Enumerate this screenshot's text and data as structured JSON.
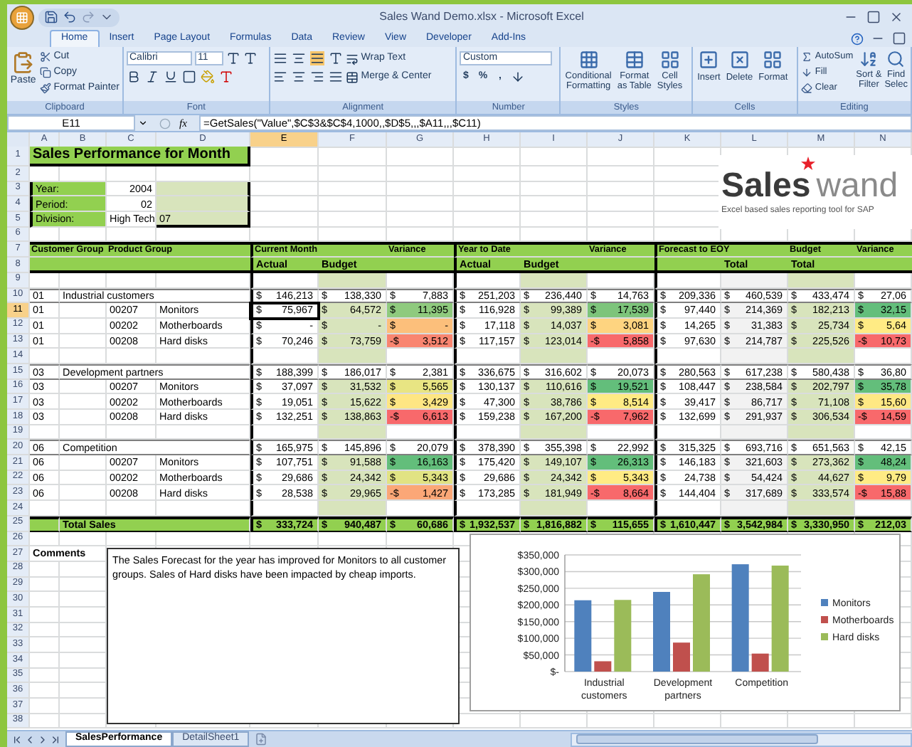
{
  "window": {
    "title": "Sales Wand Demo.xlsx - Microsoft Excel"
  },
  "ribbon": {
    "tabs": [
      {
        "label": "Home",
        "selected": true
      },
      {
        "label": "Insert",
        "selected": false
      },
      {
        "label": "Page Layout",
        "selected": false
      },
      {
        "label": "Formulas",
        "selected": false
      },
      {
        "label": "Data",
        "selected": false
      },
      {
        "label": "Review",
        "selected": false
      },
      {
        "label": "View",
        "selected": false
      },
      {
        "label": "Developer",
        "selected": false
      },
      {
        "label": "Add-Ins",
        "selected": false
      }
    ],
    "clipboard": {
      "label": "Clipboard",
      "paste": "Paste",
      "items": [
        "Cut",
        "Copy",
        "Format Painter"
      ]
    },
    "font": {
      "label": "Font",
      "family": "Calibri",
      "size": "11"
    },
    "alignment": {
      "label": "Alignment",
      "wrap": "Wrap Text",
      "merge": "Merge & Center"
    },
    "number": {
      "label": "Number",
      "format": "Custom",
      "symbols": [
        "$",
        "%",
        ","
      ]
    },
    "styles": {
      "label": "Styles",
      "buttons": [
        [
          "Conditional",
          "Formatting"
        ],
        [
          "Format",
          "as Table"
        ],
        [
          "Cell",
          "Styles"
        ]
      ]
    },
    "cells": {
      "label": "Cells",
      "buttons": [
        "Insert",
        "Delete",
        "Format"
      ]
    },
    "editing": {
      "label": "Editing",
      "items": [
        "AutoSum",
        "Fill",
        "Clear"
      ],
      "buttons": [
        [
          "Sort &",
          "Filter"
        ],
        [
          "Find",
          "Selec"
        ]
      ]
    }
  },
  "formula_bar": {
    "name_box": "E11",
    "function_label": "fx",
    "formula": "=GetSales(\"Value\",$C$3&$C$4,1000,,$D$5,,,$A11,,,$C11)"
  },
  "sheet": {
    "columns": [
      {
        "label": "A",
        "selected": false
      },
      {
        "label": "B",
        "selected": false
      },
      {
        "label": "C",
        "selected": false
      },
      {
        "label": "D",
        "selected": false
      },
      {
        "label": "E",
        "selected": true
      },
      {
        "label": "F",
        "selected": false
      },
      {
        "label": "G",
        "selected": false
      },
      {
        "label": "H",
        "selected": false
      },
      {
        "label": "I",
        "selected": false
      },
      {
        "label": "J",
        "selected": false
      },
      {
        "label": "K",
        "selected": false
      },
      {
        "label": "L",
        "selected": false
      },
      {
        "label": "M",
        "selected": false
      },
      {
        "label": "N",
        "selected": false
      }
    ],
    "rows": [
      {
        "number": "1",
        "selected": false,
        "kind": "title",
        "text": "Sales Performance for Month"
      },
      {
        "number": "2",
        "selected": false,
        "kind": "blank"
      },
      {
        "number": "3",
        "selected": false,
        "kind": "param",
        "label": "Year:",
        "value": {
          "kind": "number",
          "text": "2004"
        }
      },
      {
        "number": "4",
        "selected": false,
        "kind": "param",
        "label": "Period:",
        "value": {
          "kind": "number",
          "text": "02"
        }
      },
      {
        "number": "5",
        "selected": false,
        "kind": "param",
        "label": "Division:",
        "value": {
          "kind": "text",
          "text": "High Tech"
        },
        "extra": "07"
      },
      {
        "number": "6",
        "selected": false,
        "kind": "blank"
      },
      {
        "number": "7",
        "selected": false,
        "kind": "header1",
        "labels": [
          "Customer Group",
          "Product Group",
          "Current Month",
          "Variance",
          "Year to Date",
          "Variance",
          "Forecast to EOY",
          "Budget",
          "Variance"
        ]
      },
      {
        "number": "8",
        "selected": false,
        "kind": "header2",
        "labels": [
          "Actual",
          "Budget",
          "Actual",
          "Budget",
          "Total",
          "Total"
        ]
      },
      {
        "number": "9",
        "selected": false,
        "kind": "spacer"
      },
      {
        "number": "10",
        "selected": false,
        "kind": "group",
        "code": "01",
        "name": "Industrial customers",
        "values": [
          {
            "sign": "$",
            "amount": "146,213"
          },
          {
            "sign": "$",
            "amount": "138,330"
          },
          {
            "sign": "$",
            "amount": "7,883"
          },
          {
            "sign": "$",
            "amount": "251,203"
          },
          {
            "sign": "$",
            "amount": "236,440"
          },
          {
            "sign": "$",
            "amount": "14,763"
          },
          {
            "sign": "$",
            "amount": "209,336"
          },
          {
            "sign": "$",
            "amount": "460,539"
          },
          {
            "sign": "$",
            "amount": "433,474"
          },
          {
            "sign": "$",
            "amount": "27,06"
          }
        ]
      },
      {
        "number": "11",
        "selected": true,
        "kind": "item",
        "code": "01",
        "product_code": "00207",
        "product": "Monitors",
        "values": [
          {
            "sign": "$",
            "amount": "75,967"
          },
          {
            "sign": "$",
            "amount": "64,572"
          },
          {
            "sign": "$",
            "amount": "11,395",
            "color": "#8fca7e"
          },
          {
            "sign": "$",
            "amount": "116,928"
          },
          {
            "sign": "$",
            "amount": "99,389"
          },
          {
            "sign": "$",
            "amount": "17,539",
            "color": "#7dc47b"
          },
          {
            "sign": "$",
            "amount": "97,440"
          },
          {
            "sign": "$",
            "amount": "214,369"
          },
          {
            "sign": "$",
            "amount": "182,213"
          },
          {
            "sign": "$",
            "amount": "32,15",
            "color": "#63be7b"
          }
        ]
      },
      {
        "number": "12",
        "selected": false,
        "kind": "item",
        "code": "01",
        "product_code": "00202",
        "product": "Motherboards",
        "values": [
          {
            "sign": "$",
            "amount": "-"
          },
          {
            "sign": "$",
            "amount": "-"
          },
          {
            "sign": "$",
            "amount": "-",
            "color": "#fcbf7b"
          },
          {
            "sign": "$",
            "amount": "17,118"
          },
          {
            "sign": "$",
            "amount": "14,037"
          },
          {
            "sign": "$",
            "amount": "3,081",
            "color": "#fed480"
          },
          {
            "sign": "$",
            "amount": "14,265"
          },
          {
            "sign": "$",
            "amount": "31,383"
          },
          {
            "sign": "$",
            "amount": "25,734"
          },
          {
            "sign": "$",
            "amount": "5,64",
            "color": "#ffeb84"
          }
        ]
      },
      {
        "number": "13",
        "selected": false,
        "kind": "item",
        "code": "01",
        "product_code": "00208",
        "product": "Hard disks",
        "values": [
          {
            "sign": "$",
            "amount": "70,246"
          },
          {
            "sign": "$",
            "amount": "73,759"
          },
          {
            "sign": "-$",
            "amount": "3,512",
            "color": "#f98570"
          },
          {
            "sign": "$",
            "amount": "117,157"
          },
          {
            "sign": "$",
            "amount": "123,014"
          },
          {
            "sign": "-$",
            "amount": "5,858",
            "color": "#f8696b"
          },
          {
            "sign": "$",
            "amount": "97,630"
          },
          {
            "sign": "$",
            "amount": "214,787"
          },
          {
            "sign": "$",
            "amount": "225,526"
          },
          {
            "sign": "-$",
            "amount": "10,73",
            "color": "#f8696b"
          }
        ]
      },
      {
        "number": "14",
        "selected": false,
        "kind": "spacer"
      },
      {
        "number": "15",
        "selected": false,
        "kind": "group",
        "code": "03",
        "name": "Development partners",
        "values": [
          {
            "sign": "$",
            "amount": "188,399"
          },
          {
            "sign": "$",
            "amount": "186,017"
          },
          {
            "sign": "$",
            "amount": "2,381"
          },
          {
            "sign": "$",
            "amount": "336,675"
          },
          {
            "sign": "$",
            "amount": "316,602"
          },
          {
            "sign": "$",
            "amount": "20,073"
          },
          {
            "sign": "$",
            "amount": "280,563"
          },
          {
            "sign": "$",
            "amount": "617,238"
          },
          {
            "sign": "$",
            "amount": "580,438"
          },
          {
            "sign": "$",
            "amount": "36,80"
          }
        ]
      },
      {
        "number": "16",
        "selected": false,
        "kind": "item",
        "code": "03",
        "product_code": "00207",
        "product": "Monitors",
        "values": [
          {
            "sign": "$",
            "amount": "37,097"
          },
          {
            "sign": "$",
            "amount": "31,532"
          },
          {
            "sign": "$",
            "amount": "5,565",
            "color": "#e8e583"
          },
          {
            "sign": "$",
            "amount": "130,137"
          },
          {
            "sign": "$",
            "amount": "110,616"
          },
          {
            "sign": "$",
            "amount": "19,521",
            "color": "#63be7b"
          },
          {
            "sign": "$",
            "amount": "108,447"
          },
          {
            "sign": "$",
            "amount": "238,584"
          },
          {
            "sign": "$",
            "amount": "202,797"
          },
          {
            "sign": "$",
            "amount": "35,78",
            "color": "#63be7b"
          }
        ]
      },
      {
        "number": "17",
        "selected": false,
        "kind": "item",
        "code": "03",
        "product_code": "00202",
        "product": "Motherboards",
        "values": [
          {
            "sign": "$",
            "amount": "19,051"
          },
          {
            "sign": "$",
            "amount": "15,622"
          },
          {
            "sign": "$",
            "amount": "3,429",
            "color": "#fee683"
          },
          {
            "sign": "$",
            "amount": "47,300"
          },
          {
            "sign": "$",
            "amount": "38,786"
          },
          {
            "sign": "$",
            "amount": "8,514",
            "color": "#ffeb84"
          },
          {
            "sign": "$",
            "amount": "39,417"
          },
          {
            "sign": "$",
            "amount": "86,717"
          },
          {
            "sign": "$",
            "amount": "71,108"
          },
          {
            "sign": "$",
            "amount": "15,60",
            "color": "#ffe884"
          }
        ]
      },
      {
        "number": "18",
        "selected": false,
        "kind": "item",
        "code": "03",
        "product_code": "00208",
        "product": "Hard disks",
        "values": [
          {
            "sign": "$",
            "amount": "132,251"
          },
          {
            "sign": "$",
            "amount": "138,863"
          },
          {
            "sign": "-$",
            "amount": "6,613",
            "color": "#f8696b"
          },
          {
            "sign": "$",
            "amount": "159,238"
          },
          {
            "sign": "$",
            "amount": "167,200"
          },
          {
            "sign": "-$",
            "amount": "7,962",
            "color": "#f8696b"
          },
          {
            "sign": "$",
            "amount": "132,699"
          },
          {
            "sign": "$",
            "amount": "291,937"
          },
          {
            "sign": "$",
            "amount": "306,534"
          },
          {
            "sign": "-$",
            "amount": "14,59",
            "color": "#f8696b"
          }
        ]
      },
      {
        "number": "19",
        "selected": false,
        "kind": "spacer"
      },
      {
        "number": "20",
        "selected": false,
        "kind": "group",
        "code": "06",
        "name": "Competition",
        "values": [
          {
            "sign": "$",
            "amount": "165,975"
          },
          {
            "sign": "$",
            "amount": "145,896"
          },
          {
            "sign": "$",
            "amount": "20,079"
          },
          {
            "sign": "$",
            "amount": "378,390"
          },
          {
            "sign": "$",
            "amount": "355,398"
          },
          {
            "sign": "$",
            "amount": "22,992"
          },
          {
            "sign": "$",
            "amount": "315,325"
          },
          {
            "sign": "$",
            "amount": "693,716"
          },
          {
            "sign": "$",
            "amount": "651,563"
          },
          {
            "sign": "$",
            "amount": "42,15"
          }
        ]
      },
      {
        "number": "21",
        "selected": false,
        "kind": "item",
        "code": "06",
        "product_code": "00207",
        "product": "Monitors",
        "values": [
          {
            "sign": "$",
            "amount": "107,751"
          },
          {
            "sign": "$",
            "amount": "91,588"
          },
          {
            "sign": "$",
            "amount": "16,163",
            "color": "#63be7b"
          },
          {
            "sign": "$",
            "amount": "175,420"
          },
          {
            "sign": "$",
            "amount": "149,107"
          },
          {
            "sign": "$",
            "amount": "26,313",
            "color": "#63be7b"
          },
          {
            "sign": "$",
            "amount": "146,183"
          },
          {
            "sign": "$",
            "amount": "321,603"
          },
          {
            "sign": "$",
            "amount": "273,362"
          },
          {
            "sign": "$",
            "amount": "48,24",
            "color": "#63be7b"
          }
        ]
      },
      {
        "number": "22",
        "selected": false,
        "kind": "item",
        "code": "06",
        "product_code": "00202",
        "product": "Motherboards",
        "values": [
          {
            "sign": "$",
            "amount": "29,686"
          },
          {
            "sign": "$",
            "amount": "24,342"
          },
          {
            "sign": "$",
            "amount": "5,343",
            "color": "#e1e383"
          },
          {
            "sign": "$",
            "amount": "29,686"
          },
          {
            "sign": "$",
            "amount": "24,342"
          },
          {
            "sign": "$",
            "amount": "5,343",
            "color": "#ffeb84"
          },
          {
            "sign": "$",
            "amount": "24,738"
          },
          {
            "sign": "$",
            "amount": "54,424"
          },
          {
            "sign": "$",
            "amount": "44,627"
          },
          {
            "sign": "$",
            "amount": "9,79",
            "color": "#ffeb84"
          }
        ]
      },
      {
        "number": "23",
        "selected": false,
        "kind": "item",
        "code": "06",
        "product_code": "00208",
        "product": "Hard disks",
        "values": [
          {
            "sign": "$",
            "amount": "28,538"
          },
          {
            "sign": "$",
            "amount": "29,965"
          },
          {
            "sign": "-$",
            "amount": "1,427",
            "color": "#fba777"
          },
          {
            "sign": "$",
            "amount": "173,285"
          },
          {
            "sign": "$",
            "amount": "181,949"
          },
          {
            "sign": "-$",
            "amount": "8,664",
            "color": "#f8696b"
          },
          {
            "sign": "$",
            "amount": "144,404"
          },
          {
            "sign": "$",
            "amount": "317,689"
          },
          {
            "sign": "$",
            "amount": "333,574"
          },
          {
            "sign": "-$",
            "amount": "15,88",
            "color": "#f8696b"
          }
        ]
      },
      {
        "number": "24",
        "selected": false,
        "kind": "spacer"
      },
      {
        "number": "25",
        "selected": false,
        "kind": "total",
        "name": "Total Sales",
        "values": [
          {
            "sign": "$",
            "amount": "333,724"
          },
          {
            "sign": "$",
            "amount": "940,487"
          },
          {
            "sign": "$",
            "amount": "60,686"
          },
          {
            "sign": "$",
            "amount": "1,932,537"
          },
          {
            "sign": "$",
            "amount": "1,816,882"
          },
          {
            "sign": "$",
            "amount": "115,655"
          },
          {
            "sign": "$",
            "amount": "1,610,447"
          },
          {
            "sign": "$",
            "amount": "3,542,984"
          },
          {
            "sign": "$",
            "amount": "3,330,950"
          },
          {
            "sign": "$",
            "amount": "212,03"
          }
        ]
      },
      {
        "number": "26",
        "selected": false,
        "kind": "blank"
      },
      {
        "number": "27",
        "selected": false,
        "kind": "label",
        "text": "Comments"
      },
      {
        "number": "28",
        "selected": false,
        "kind": "blank"
      },
      {
        "number": "29",
        "selected": false,
        "kind": "blank"
      },
      {
        "number": "30",
        "selected": false,
        "kind": "blank"
      },
      {
        "number": "31",
        "selected": false,
        "kind": "blank"
      },
      {
        "number": "32",
        "selected": false,
        "kind": "blank"
      },
      {
        "number": "33",
        "selected": false,
        "kind": "blank"
      },
      {
        "number": "34",
        "selected": false,
        "kind": "blank"
      },
      {
        "number": "35",
        "selected": false,
        "kind": "blank"
      },
      {
        "number": "36",
        "selected": false,
        "kind": "blank"
      },
      {
        "number": "37",
        "selected": false,
        "kind": "blank"
      },
      {
        "number": "38",
        "selected": false,
        "kind": "blank"
      }
    ],
    "logo": {
      "first": "Sales",
      "second": "wand",
      "tagline": "Excel based sales reporting tool for SAP"
    },
    "comment_box": {
      "text": "The Sales Forecast for the year has improved for Monitors to all customer groups. Sales of Hard disks have been impacted by cheap imports."
    },
    "chart": {
      "chart_data": {
        "type": "bar",
        "categories": [
          "Industrial customers",
          "Development partners",
          "Competition"
        ],
        "series": [
          {
            "name": "Monitors",
            "color": "#4f81bd",
            "values": [
              214000,
              239000,
              322000
            ]
          },
          {
            "name": "Motherboards",
            "color": "#c0504d",
            "values": [
              31000,
              87000,
              54000
            ]
          },
          {
            "name": "Hard disks",
            "color": "#9bbb59",
            "values": [
              215000,
              292000,
              318000
            ]
          }
        ],
        "grid": true,
        "legend": "right",
        "ylim": [
          0,
          350000
        ],
        "yticks": [
          {
            "value": 0,
            "label": "$-"
          },
          {
            "value": 50000,
            "label": "$50,000"
          },
          {
            "value": 100000,
            "label": "$100,000"
          },
          {
            "value": 150000,
            "label": "$150,000"
          },
          {
            "value": 200000,
            "label": "$200,000"
          },
          {
            "value": 250000,
            "label": "$250,000"
          },
          {
            "value": 300000,
            "label": "$300,000"
          },
          {
            "value": 350000,
            "label": "$350,000"
          }
        ]
      }
    },
    "tabs": [
      {
        "label": "SalesPerformance",
        "selected": true
      },
      {
        "label": "DetailSheet1",
        "selected": false
      }
    ]
  }
}
